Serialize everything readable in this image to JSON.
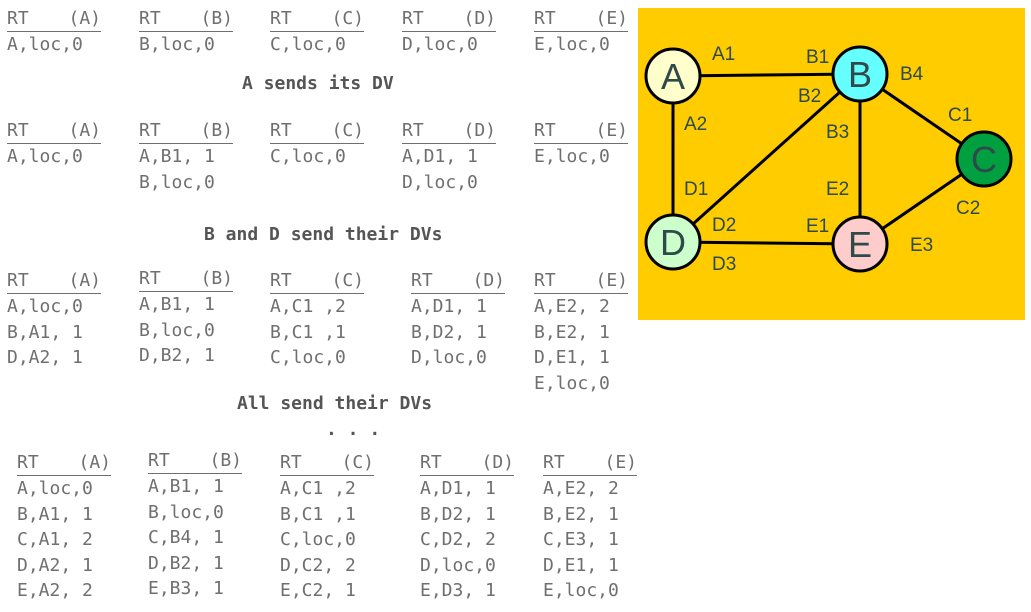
{
  "stages": [
    {
      "tables": [
        {
          "title": "RT",
          "node": "(A)",
          "rows": [
            "A,loc,0"
          ]
        },
        {
          "title": "RT",
          "node": "(B)",
          "rows": [
            "B,loc,0"
          ]
        },
        {
          "title": "RT",
          "node": "(C)",
          "rows": [
            "C,loc,0"
          ]
        },
        {
          "title": "RT",
          "node": "(D)",
          "rows": [
            "D,loc,0"
          ]
        },
        {
          "title": "RT",
          "node": "(E)",
          "rows": [
            "E,loc,0"
          ]
        }
      ],
      "caption": "A sends its DV"
    },
    {
      "tables": [
        {
          "title": "RT",
          "node": "(A)",
          "rows": [
            "A,loc,0"
          ]
        },
        {
          "title": "RT",
          "node": "(B)",
          "rows": [
            "A,B1, 1",
            "B,loc,0"
          ]
        },
        {
          "title": "RT",
          "node": "(C)",
          "rows": [
            "C,loc,0"
          ]
        },
        {
          "title": "RT",
          "node": "(D)",
          "rows": [
            "A,D1, 1",
            "D,loc,0"
          ]
        },
        {
          "title": "RT",
          "node": "(E)",
          "rows": [
            "E,loc,0"
          ]
        }
      ],
      "caption": "B and D send their DVs"
    },
    {
      "tables": [
        {
          "title": "RT",
          "node": "(A)",
          "rows": [
            "A,loc,0",
            "B,A1, 1",
            "D,A2, 1"
          ]
        },
        {
          "title": "RT",
          "node": "(B)",
          "rows": [
            "A,B1, 1",
            "B,loc,0",
            "D,B2, 1"
          ]
        },
        {
          "title": "RT",
          "node": "(C)",
          "rows": [
            "A,C1 ,2",
            "B,C1 ,1",
            "C,loc,0"
          ]
        },
        {
          "title": "RT",
          "node": "(D)",
          "rows": [
            "A,D1, 1",
            "B,D2, 1",
            "D,loc,0"
          ]
        },
        {
          "title": "RT",
          "node": "(E)",
          "rows": [
            "A,E2, 2",
            "B,E2, 1",
            "D,E1, 1",
            "E,loc,0"
          ]
        }
      ],
      "caption": "All send their DVs"
    },
    {
      "tables": [
        {
          "title": "RT",
          "node": "(A)",
          "rows": [
            "A,loc,0",
            "B,A1, 1",
            "C,A1, 2",
            "D,A2, 1",
            "E,A2, 2"
          ]
        },
        {
          "title": "RT",
          "node": "(B)",
          "rows": [
            "A,B1, 1",
            "B,loc,0",
            "C,B4, 1",
            "D,B2, 1",
            "E,B3, 1"
          ]
        },
        {
          "title": "RT",
          "node": "(C)",
          "rows": [
            "A,C1 ,2",
            "B,C1 ,1",
            "C,loc,0",
            "D,C2, 2",
            "E,C2, 1"
          ]
        },
        {
          "title": "RT",
          "node": "(D)",
          "rows": [
            "A,D1, 1",
            "B,D2, 1",
            "C,D2, 2",
            "D,loc,0",
            "E,D3, 1"
          ]
        },
        {
          "title": "RT",
          "node": "(E)",
          "rows": [
            "A,E2, 2",
            "B,E2, 1",
            "C,E3, 1",
            "D,E1, 1",
            "E,loc,0"
          ]
        }
      ],
      "caption": ""
    }
  ],
  "ellipsis": ". . .",
  "graph": {
    "background": "#ffcc00",
    "edge_color": "#000000",
    "nodes": [
      {
        "id": "A",
        "label": "A",
        "fill": "#ffffcc"
      },
      {
        "id": "B",
        "label": "B",
        "fill": "#66ffff"
      },
      {
        "id": "C",
        "label": "C",
        "fill": "#00a040"
      },
      {
        "id": "D",
        "label": "D",
        "fill": "#ccffcc"
      },
      {
        "id": "E",
        "label": "E",
        "fill": "#ffcccc"
      }
    ],
    "edges": [
      {
        "from": "A",
        "to": "B"
      },
      {
        "from": "A",
        "to": "D"
      },
      {
        "from": "B",
        "to": "C"
      },
      {
        "from": "B",
        "to": "D"
      },
      {
        "from": "B",
        "to": "E"
      },
      {
        "from": "C",
        "to": "E"
      },
      {
        "from": "D",
        "to": "E"
      }
    ],
    "ports": [
      "A1",
      "A2",
      "B1",
      "B2",
      "B3",
      "B4",
      "C1",
      "C2",
      "D1",
      "D2",
      "D3",
      "E1",
      "E2",
      "E3"
    ]
  }
}
